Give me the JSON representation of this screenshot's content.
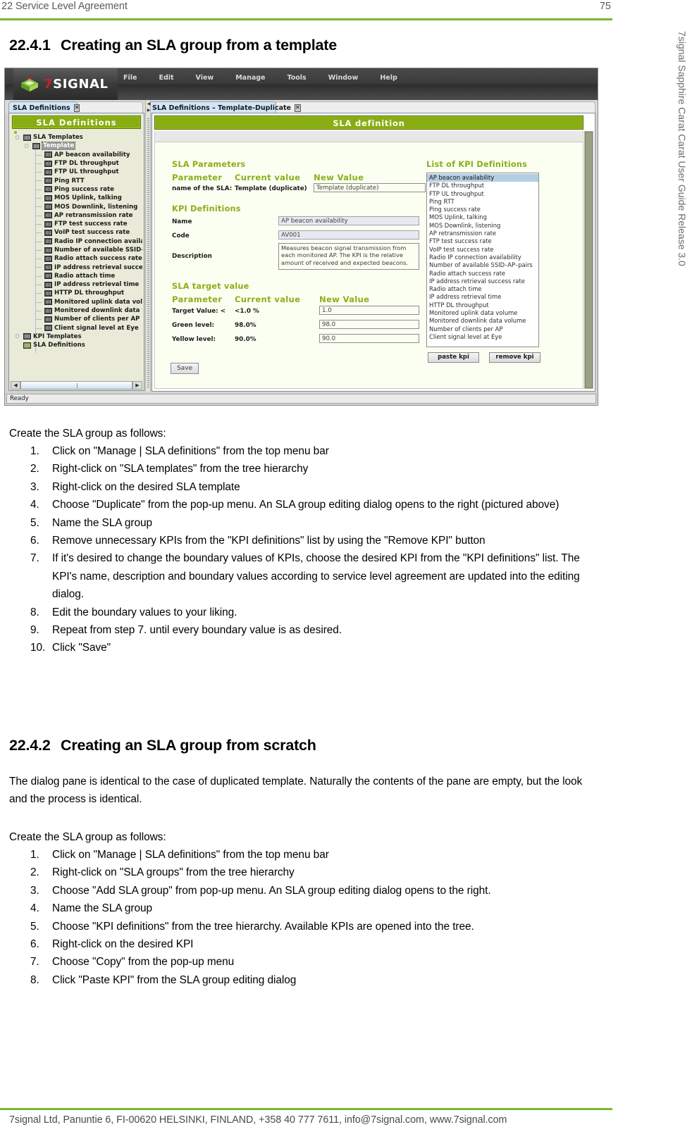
{
  "page": {
    "header_left": "22 Service Level Agreement",
    "header_right": "75",
    "side_note": "7signal Sapphire Carat Carat User Guide Release 3.0",
    "footer": "7signal Ltd, Panuntie 6, FI-00620 HELSINKI, FINLAND, +358 40 777 7611, info@7signal.com, www.7signal.com",
    "accent_green": "#7ab730"
  },
  "section_1": {
    "number": "22.4.1",
    "title": "Creating an SLA group from a template",
    "intro": "Create the SLA group as follows:",
    "steps": [
      {
        "mark": "1.",
        "text": "Click on \"Manage | SLA definitions\" from the top menu bar"
      },
      {
        "mark": "2.",
        "text": "Right-click on \"SLA templates\" from the tree hierarchy"
      },
      {
        "mark": "3.",
        "text": "Right-click on the desired SLA template"
      },
      {
        "mark": "4.",
        "text": "Choose \"Duplicate\" from the pop-up menu. An SLA group editing dialog opens to the right (pictured above)"
      },
      {
        "mark": "5.",
        "text": "Name the SLA group"
      },
      {
        "mark": "6.",
        "text": "Remove unnecessary KPIs from the \"KPI definitions\" list by using the \"Remove KPI\" button"
      },
      {
        "mark": "7.",
        "text": "If it's desired to change the boundary values of KPIs, choose the desired KPI from the \"KPI definitions\" list. The KPI's name, description and boundary values according to service level agreement are updated into the editing dialog."
      },
      {
        "mark": "8.",
        "text": "Edit the boundary values to your liking."
      },
      {
        "mark": "9.",
        "text": "Repeat from step 7. until every boundary value is as desired."
      },
      {
        "mark": "10.",
        "text": "Click \"Save\""
      }
    ]
  },
  "section_2": {
    "number": "22.4.2",
    "title": "Creating an SLA group from scratch",
    "paragraph": "The dialog pane is identical to the case of duplicated template. Naturally the contents of the pane are empty, but the look and the process is identical.",
    "intro": "Create the SLA group as follows:",
    "steps": [
      {
        "mark": "1.",
        "text": "Click on \"Manage | SLA definitions\" from the top menu bar"
      },
      {
        "mark": "2.",
        "text": "Right-click on \"SLA groups\" from the tree hierarchy"
      },
      {
        "mark": "3.",
        "text": "Choose \"Add SLA group\" from pop-up menu. An SLA group editing dialog opens to the right."
      },
      {
        "mark": "4.",
        "text": "Name the SLA group"
      },
      {
        "mark": "5.",
        "text": "Choose \"KPI definitions\" from the tree hierarchy. Available KPIs are opened into the tree."
      },
      {
        "mark": "6.",
        "text": "Right-click on the desired KPI"
      },
      {
        "mark": "7.",
        "text": "Choose \"Copy\" from the pop-up menu"
      },
      {
        "mark": "8.",
        "text": "Click \"Paste KPI\" from the SLA group editing dialog"
      }
    ]
  },
  "app": {
    "brand": {
      "seven": "7",
      "signal": "SIGNAL"
    },
    "menu": [
      "File",
      "Edit",
      "View",
      "Manage",
      "Tools",
      "Window",
      "Help"
    ],
    "tabs": [
      {
        "label": "SLA Definitions",
        "close": "✕"
      },
      {
        "label": "SLA Definitions – Template-Duplicate",
        "close": "✕"
      }
    ],
    "tree_panel": {
      "title": "SLA Definitions",
      "nodes": [
        {
          "level": 0,
          "handle": "♀",
          "label": "SLA Templates",
          "icon": "folder-icon",
          "selected": false
        },
        {
          "level": 1,
          "handle": "♀",
          "label": "Template",
          "icon": "template-icon",
          "selected": true
        },
        {
          "level": 2,
          "handle": "",
          "label": "AP beacon availability",
          "icon": "kpi-icon",
          "selected": false
        },
        {
          "level": 2,
          "handle": "",
          "label": "FTP DL throughput",
          "icon": "kpi-icon",
          "selected": false
        },
        {
          "level": 2,
          "handle": "",
          "label": "FTP UL throughput",
          "icon": "kpi-icon",
          "selected": false
        },
        {
          "level": 2,
          "handle": "",
          "label": "Ping RTT",
          "icon": "kpi-icon",
          "selected": false
        },
        {
          "level": 2,
          "handle": "",
          "label": "Ping success rate",
          "icon": "kpi-icon",
          "selected": false
        },
        {
          "level": 2,
          "handle": "",
          "label": "MOS Uplink, talking",
          "icon": "kpi-icon",
          "selected": false
        },
        {
          "level": 2,
          "handle": "",
          "label": "MOS Downlink, listening",
          "icon": "kpi-icon",
          "selected": false
        },
        {
          "level": 2,
          "handle": "",
          "label": "AP retransmission rate",
          "icon": "kpi-icon",
          "selected": false
        },
        {
          "level": 2,
          "handle": "",
          "label": "FTP test success rate",
          "icon": "kpi-icon",
          "selected": false
        },
        {
          "level": 2,
          "handle": "",
          "label": "VoIP test success rate",
          "icon": "kpi-icon",
          "selected": false
        },
        {
          "level": 2,
          "handle": "",
          "label": "Radio IP connection availability",
          "icon": "kpi-icon",
          "selected": false
        },
        {
          "level": 2,
          "handle": "",
          "label": "Number of available SSID–AP–p",
          "icon": "kpi-icon",
          "selected": false
        },
        {
          "level": 2,
          "handle": "",
          "label": "Radio attach success rate",
          "icon": "kpi-icon",
          "selected": false
        },
        {
          "level": 2,
          "handle": "",
          "label": "IP address retrieval success rate",
          "icon": "kpi-icon",
          "selected": false
        },
        {
          "level": 2,
          "handle": "",
          "label": "Radio attach time",
          "icon": "kpi-icon",
          "selected": false
        },
        {
          "level": 2,
          "handle": "",
          "label": "IP address retrieval time",
          "icon": "kpi-icon",
          "selected": false
        },
        {
          "level": 2,
          "handle": "",
          "label": "HTTP DL throughput",
          "icon": "kpi-icon",
          "selected": false
        },
        {
          "level": 2,
          "handle": "",
          "label": "Monitored uplink data volume",
          "icon": "kpi-icon",
          "selected": false
        },
        {
          "level": 2,
          "handle": "",
          "label": "Monitored downlink data volum",
          "icon": "kpi-icon",
          "selected": false
        },
        {
          "level": 2,
          "handle": "",
          "label": "Number of clients per AP",
          "icon": "kpi-icon",
          "selected": false
        },
        {
          "level": 2,
          "handle": "",
          "label": "Client signal level at Eye",
          "icon": "kpi-icon",
          "selected": false
        },
        {
          "level": 0,
          "handle": "♂",
          "label": "KPI Templates",
          "icon": "folder-icon",
          "selected": false
        },
        {
          "level": 0,
          "handle": "",
          "label": "SLA Definitions",
          "icon": "folder-green-icon",
          "selected": false
        }
      ]
    },
    "dialog": {
      "title": "SLA definition",
      "sla_parameters": {
        "heading": "SLA Parameters",
        "col_parameter": "Parameter",
        "col_current": "Current value",
        "col_new": "New Value",
        "row_label": "name of the SLA:",
        "row_current": "Template (duplicate)",
        "row_new_value": "Template (duplicate)"
      },
      "kpi_definitions": {
        "heading": "KPI Definitions",
        "name_label": "Name",
        "name_value": "AP beacon availability",
        "code_label": "Code",
        "code_value": "AV001",
        "description_label": "Description",
        "description_value": "Measures beacon signal transmission from each monitored AP. The KPI is the relative amount of received and expected beacons."
      },
      "sla_target": {
        "heading": "SLA target value",
        "col_parameter": "Parameter",
        "col_current": "Current value",
        "col_new": "New Value",
        "rows": [
          {
            "label": "Target Value: <",
            "current": "<1.0 %",
            "new": "1.0"
          },
          {
            "label": "Green level:",
            "current": "98.0%",
            "new": "98.0"
          },
          {
            "label": "Yellow level:",
            "current": "90.0%",
            "new": "90.0"
          }
        ]
      },
      "kpi_list": {
        "heading": "List of KPI Definitions",
        "items": [
          "AP beacon availability",
          "FTP DL throughput",
          "FTP UL throughput",
          "Ping RTT",
          "Ping success rate",
          "MOS Uplink, talking",
          "MOS Downlink, listening",
          "AP retransmission rate",
          "FTP test success rate",
          "VoIP test success rate",
          "Radio IP connection availability",
          "Number of available SSID–AP–pairs",
          "Radio attach success rate",
          "IP address retrieval success rate",
          "Radio attach time",
          "IP address retrieval time",
          "HTTP DL throughput",
          "Monitored uplink data volume",
          "Monitored downlink data volume",
          "Number of clients per AP",
          "Client signal level at Eye"
        ],
        "selected_index": 0
      },
      "buttons": {
        "paste_kpi": "paste kpi",
        "remove_kpi": "remove kpi",
        "save": "Save"
      }
    },
    "status": "Ready"
  }
}
